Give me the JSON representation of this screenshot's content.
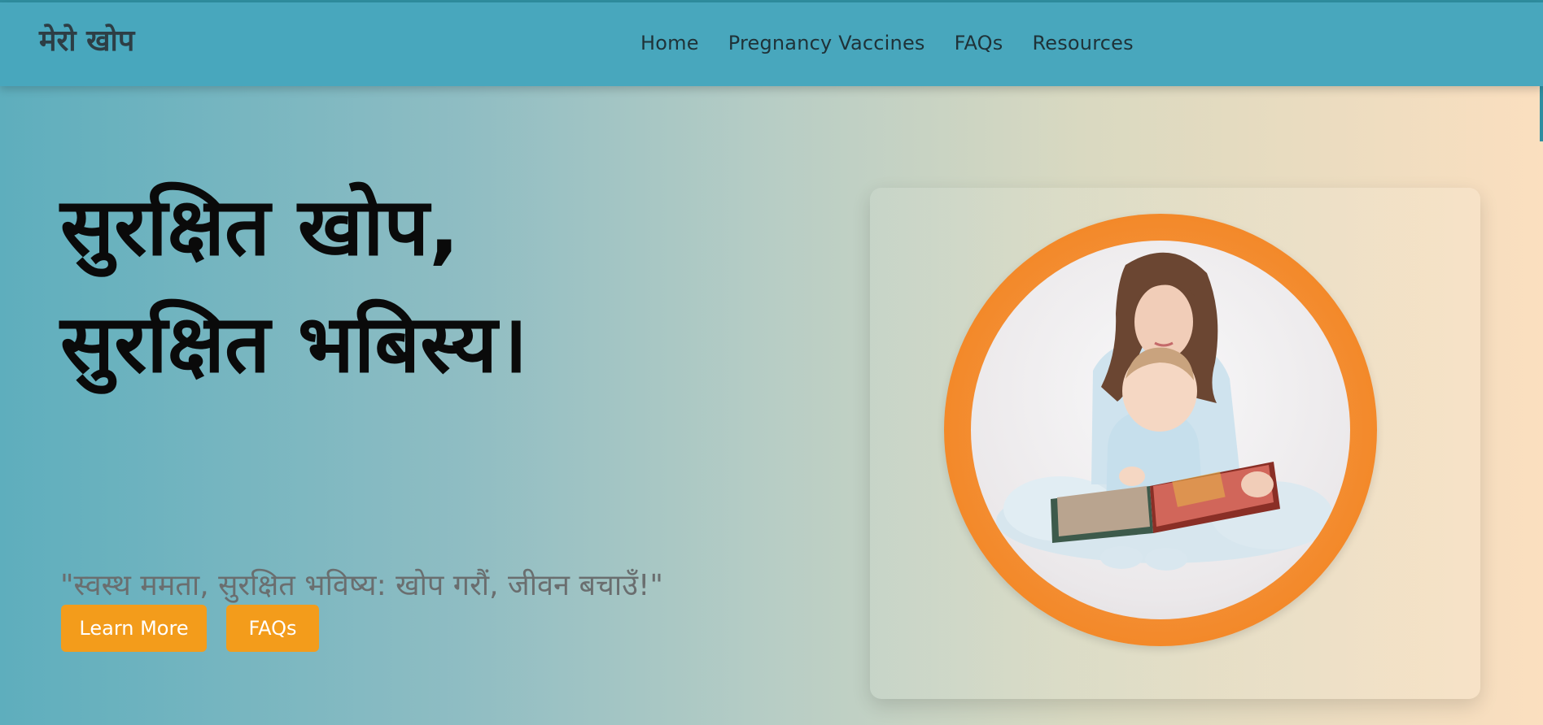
{
  "header": {
    "brand": "मेरो खोप",
    "nav": [
      "Home",
      "Pregnancy Vaccines",
      "FAQs",
      "Resources"
    ]
  },
  "hero": {
    "headline_line1": "सुरक्षित खोप,",
    "headline_line2": "सुरक्षित भबिस्य।",
    "tagline": "\"स्वस्थ ममता, सुरक्षित भविष्य: खोप गरौं, जीवन बचाउँ!\"",
    "learn_more_label": "Learn More",
    "faq_label": "FAQs"
  },
  "image": {
    "subject": "mother-reading-book-to-baby"
  },
  "colors": {
    "navbar": "#48a7bd",
    "button": "#f39c1b",
    "ring": "#f3892a",
    "gradient_start": "#5eaebd",
    "gradient_end": "#fbdfbf"
  }
}
